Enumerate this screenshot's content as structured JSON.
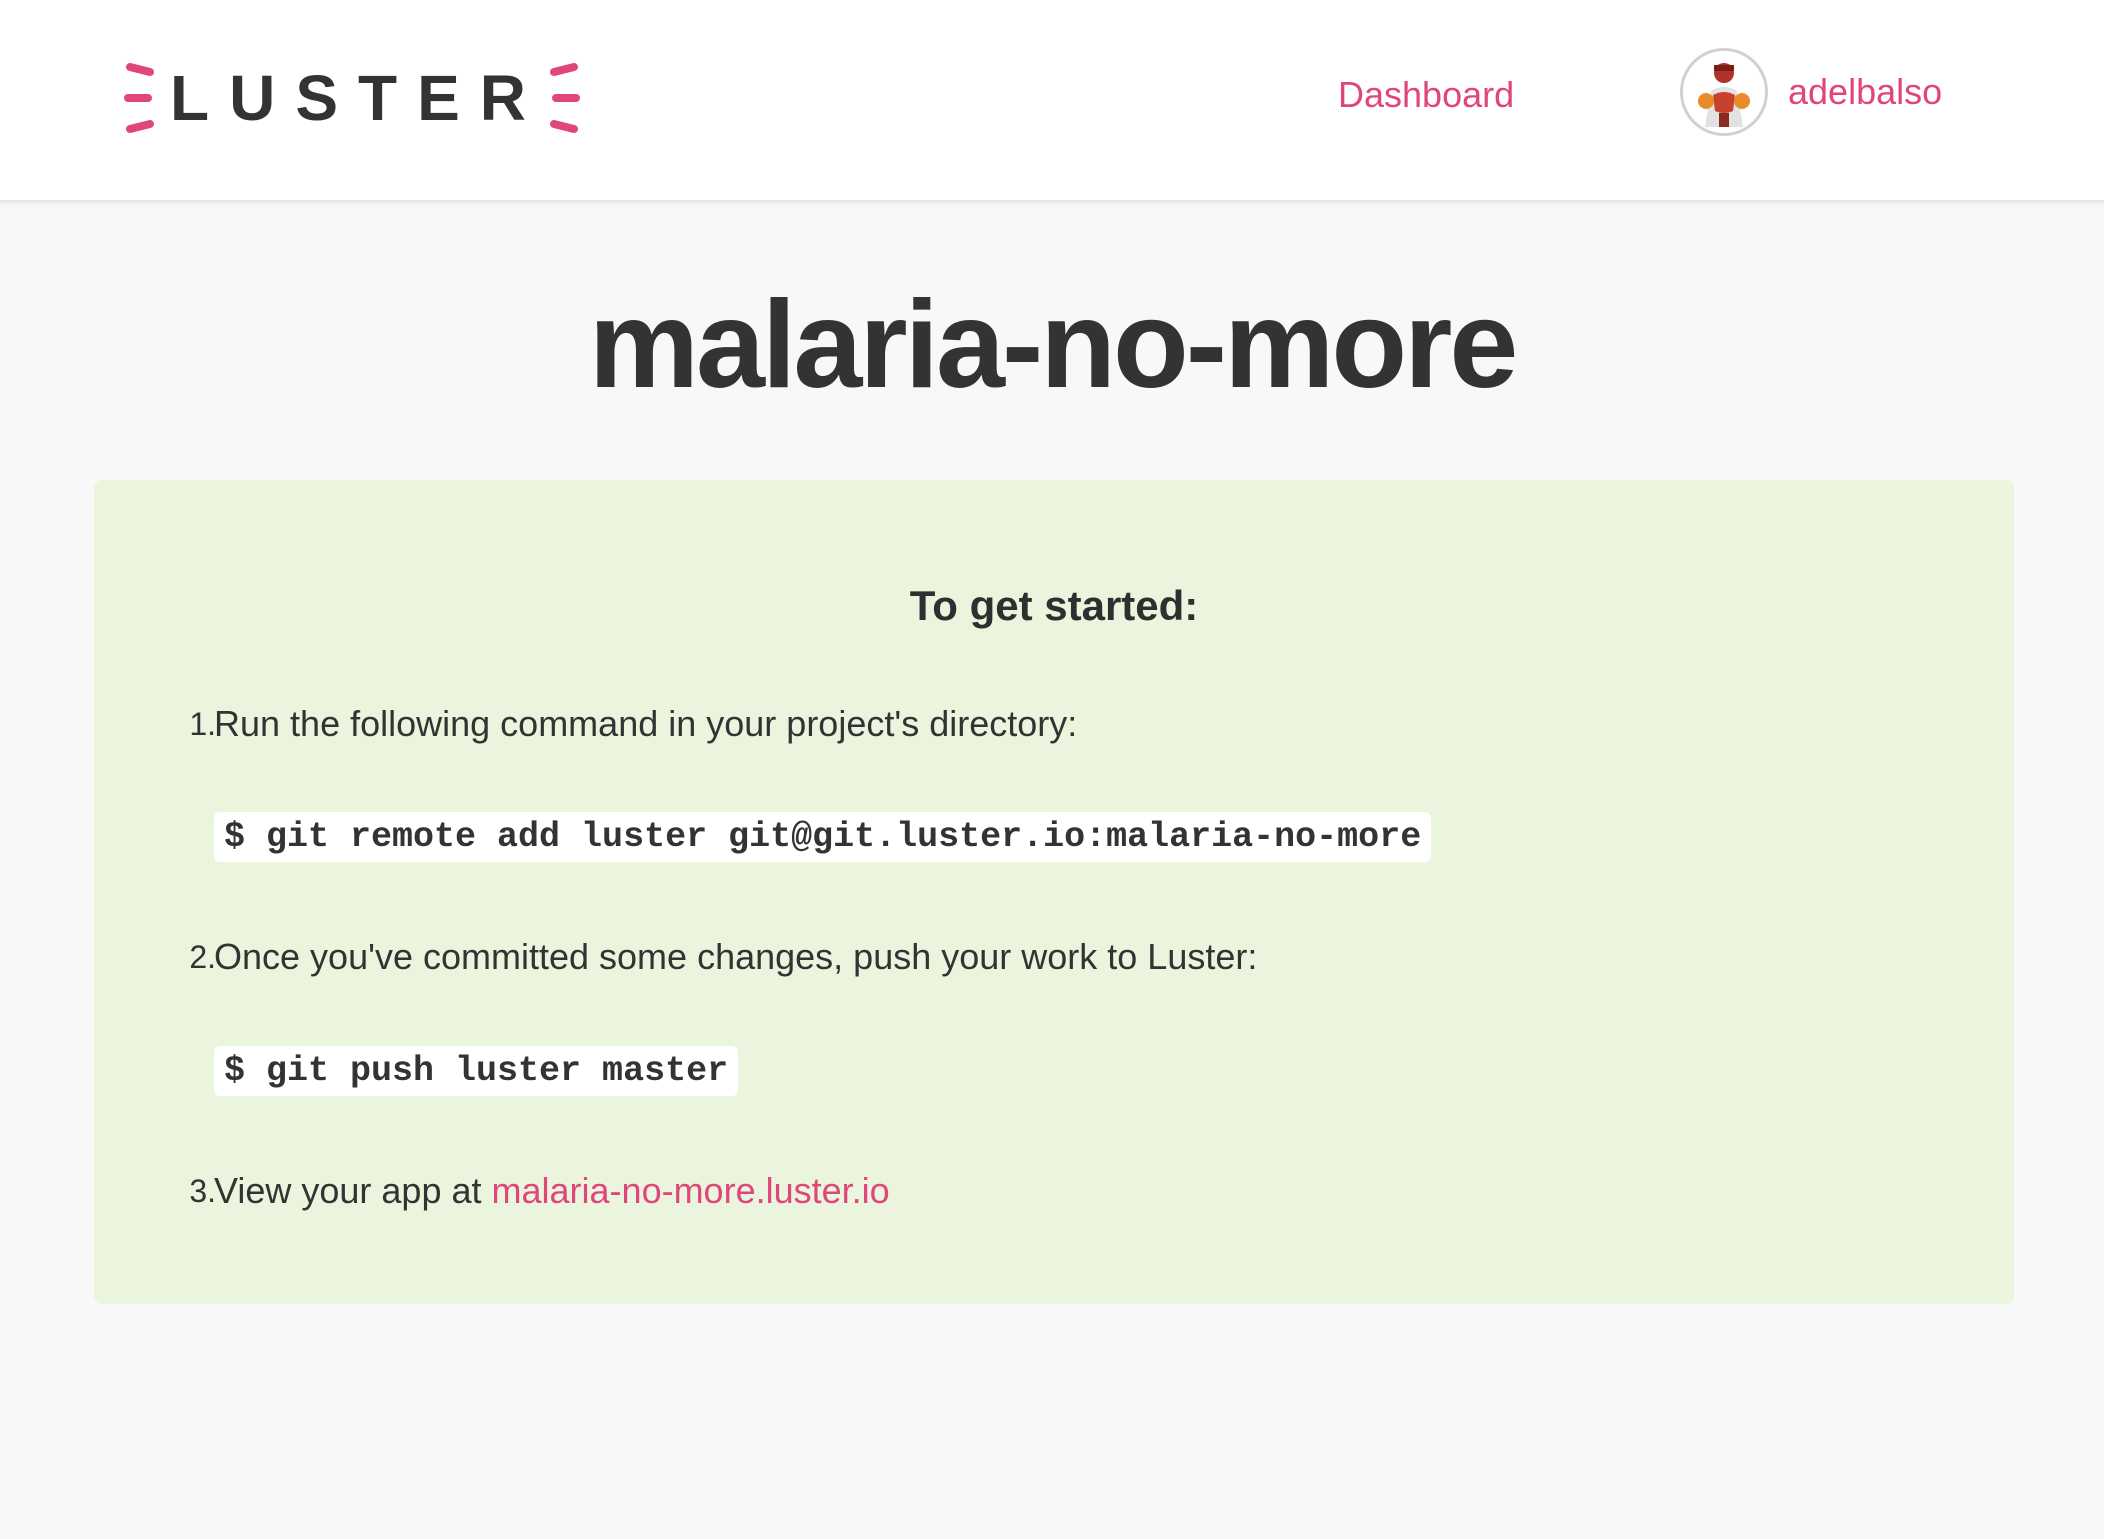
{
  "header": {
    "logo_text": "LUSTER",
    "nav_dashboard": "Dashboard",
    "username": "adelbalso"
  },
  "page": {
    "title": "malaria-no-more"
  },
  "getting_started": {
    "heading": "To get started:",
    "steps": [
      {
        "number": "1.",
        "text": "Run the following command in your project's directory:",
        "code": "$ git remote add luster git@git.luster.io:malaria-no-more"
      },
      {
        "number": "2.",
        "text": "Once you've committed some changes, push your work to Luster:",
        "code": "$ git push luster master"
      },
      {
        "number": "3.",
        "text": "View your app at ",
        "link": "malaria-no-more.luster.io"
      }
    ]
  },
  "colors": {
    "accent": "#e0457b",
    "panel_background": "#ebf5dd",
    "page_background": "#f8f8f8",
    "text": "#333333"
  },
  "icons": {
    "logo_rays": "luster-ray-icon",
    "avatar": "user-avatar"
  }
}
